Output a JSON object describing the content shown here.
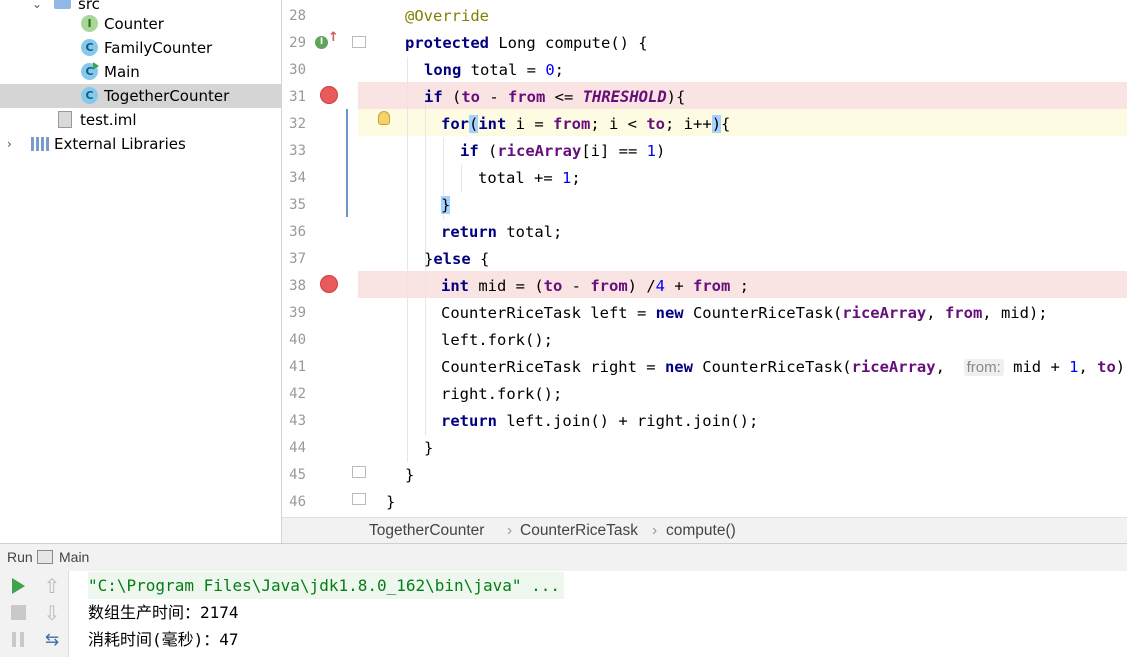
{
  "project_tree": {
    "src_label": "src",
    "items": [
      {
        "label": "Counter",
        "kind": "I"
      },
      {
        "label": "FamilyCounter",
        "kind": "C"
      },
      {
        "label": "Main",
        "kind": "C"
      },
      {
        "label": "TogetherCounter",
        "kind": "C"
      }
    ],
    "file_label": "test.iml",
    "external_label": "External Libraries"
  },
  "editor": {
    "line_numbers": [
      "28",
      "29",
      "30",
      "31",
      "32",
      "33",
      "34",
      "35",
      "36",
      "37",
      "38",
      "39",
      "40",
      "41",
      "42",
      "43",
      "44",
      "45",
      "46"
    ],
    "code": {
      "l28": "@Override",
      "l29_kw": "protected",
      "l29_rest": " Long compute() {",
      "l30_kw": "long",
      "l30_rest": " total = ",
      "l30_num": "0",
      "l30_end": ";",
      "l31_if": "if",
      "l31_a": " (",
      "l31_to": "to",
      "l31_b": " - ",
      "l31_from": "from",
      "l31_c": " <= ",
      "l31_th": "THRESHOLD",
      "l31_d": ")",
      "l31_e": "{",
      "l32_for": "for",
      "l32_a": "(",
      "l32_int": "int",
      "l32_b": " i = ",
      "l32_from": "from",
      "l32_c": "; i < ",
      "l32_to": "to",
      "l32_d": "; i++",
      "l32_e": ")",
      "l32_f": "{",
      "l33_if": "if",
      "l33_a": " (",
      "l33_arr": "riceArray",
      "l33_b": "[i] == ",
      "l33_num": "1",
      "l33_c": ")",
      "l34_a": "total += ",
      "l34_num": "1",
      "l34_b": ";",
      "l35": "}",
      "l36_kw": "return",
      "l36_rest": " total;",
      "l37_a": "}",
      "l37_kw": "else",
      "l37_b": " {",
      "l38_int": "int",
      "l38_a": " mid = (",
      "l38_to": "to",
      "l38_b": " - ",
      "l38_from": "from",
      "l38_c": ") /",
      "l38_num": "4",
      "l38_d": " + ",
      "l38_from2": "from",
      "l38_e": " ;",
      "l39_a": "CounterRiceTask left = ",
      "l39_new": "new",
      "l39_b": " CounterRiceTask(",
      "l39_arr": "riceArray",
      "l39_c": ", ",
      "l39_from": "from",
      "l39_d": ", mid);",
      "l40": "left.fork();",
      "l41_a": "CounterRiceTask right = ",
      "l41_new": "new",
      "l41_b": " CounterRiceTask(",
      "l41_arr": "riceArray",
      "l41_c": ",  ",
      "l41_hint": "from:",
      "l41_d": " mid + ",
      "l41_num": "1",
      "l41_e": ", ",
      "l41_to": "to",
      "l41_f": ");",
      "l42": "right.fork();",
      "l43_kw": "return",
      "l43_rest": " left.join() + right.join();",
      "l44": "}",
      "l45": "}",
      "l46": "}"
    }
  },
  "breadcrumb": {
    "items": [
      "TogetherCounter",
      "CounterRiceTask",
      "compute()"
    ],
    "separator": "›"
  },
  "run_panel": {
    "tab_label": "Run",
    "config_label": "Main",
    "output": [
      "\"C:\\Program Files\\Java\\jdk1.8.0_162\\bin\\java\" ...",
      "数组生产时间：2174",
      "消耗时间(毫秒)：47"
    ]
  },
  "colors": {
    "breakpoint": "#e95a5a",
    "breakpoint_line": "#fae3e3",
    "current_line": "#fdfce3",
    "keyword": "#000080",
    "field": "#660e7a",
    "number": "#0000ff",
    "annotation": "#808000",
    "run_green": "#3fa34d"
  },
  "icons": [
    "folder-icon",
    "interface-icon",
    "class-icon",
    "main-class-icon",
    "file-icon",
    "library-icon",
    "breakpoint-icon",
    "override-icon",
    "bulb-icon",
    "run-icon",
    "stop-icon",
    "pause-icon",
    "up-icon",
    "down-icon",
    "wrap-icon"
  ]
}
